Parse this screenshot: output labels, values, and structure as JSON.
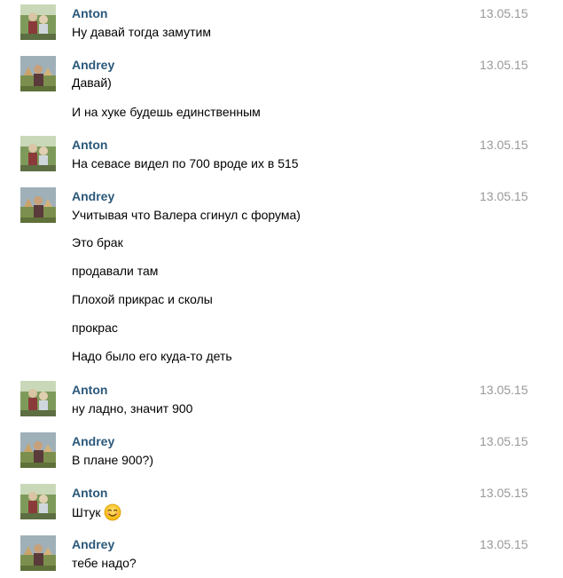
{
  "messages": [
    {
      "author": "Anton",
      "time": "13.05.15",
      "lines": [
        "Ну давай тогда замутим"
      ]
    },
    {
      "author": "Andrey",
      "time": "13.05.15",
      "lines": [
        "Давай)",
        "И на хуке будешь единственным"
      ]
    },
    {
      "author": "Anton",
      "time": "13.05.15",
      "lines": [
        "На севасе видел по 700 вроде их в 515"
      ]
    },
    {
      "author": "Andrey",
      "time": "13.05.15",
      "lines": [
        "Учитывая что Валера сгинул с форума)",
        "Это брак",
        "продавали там",
        "Плохой прикрас и сколы",
        "прокрас",
        "Надо было его куда-то деть"
      ]
    },
    {
      "author": "Anton",
      "time": "13.05.15",
      "lines": [
        "ну ладно, значит 900"
      ]
    },
    {
      "author": "Andrey",
      "time": "13.05.15",
      "lines": [
        "В плане 900?)"
      ]
    },
    {
      "author": "Anton",
      "time": "13.05.15",
      "lines": [
        "Штук"
      ],
      "emoji": "smiling-face-emoji"
    },
    {
      "author": "Andrey",
      "time": "13.05.15",
      "lines": [
        "тебе надо?"
      ]
    }
  ],
  "colors": {
    "author_name": "#2b587a",
    "timestamp": "#999999",
    "text": "#000000",
    "background": "#ffffff"
  }
}
